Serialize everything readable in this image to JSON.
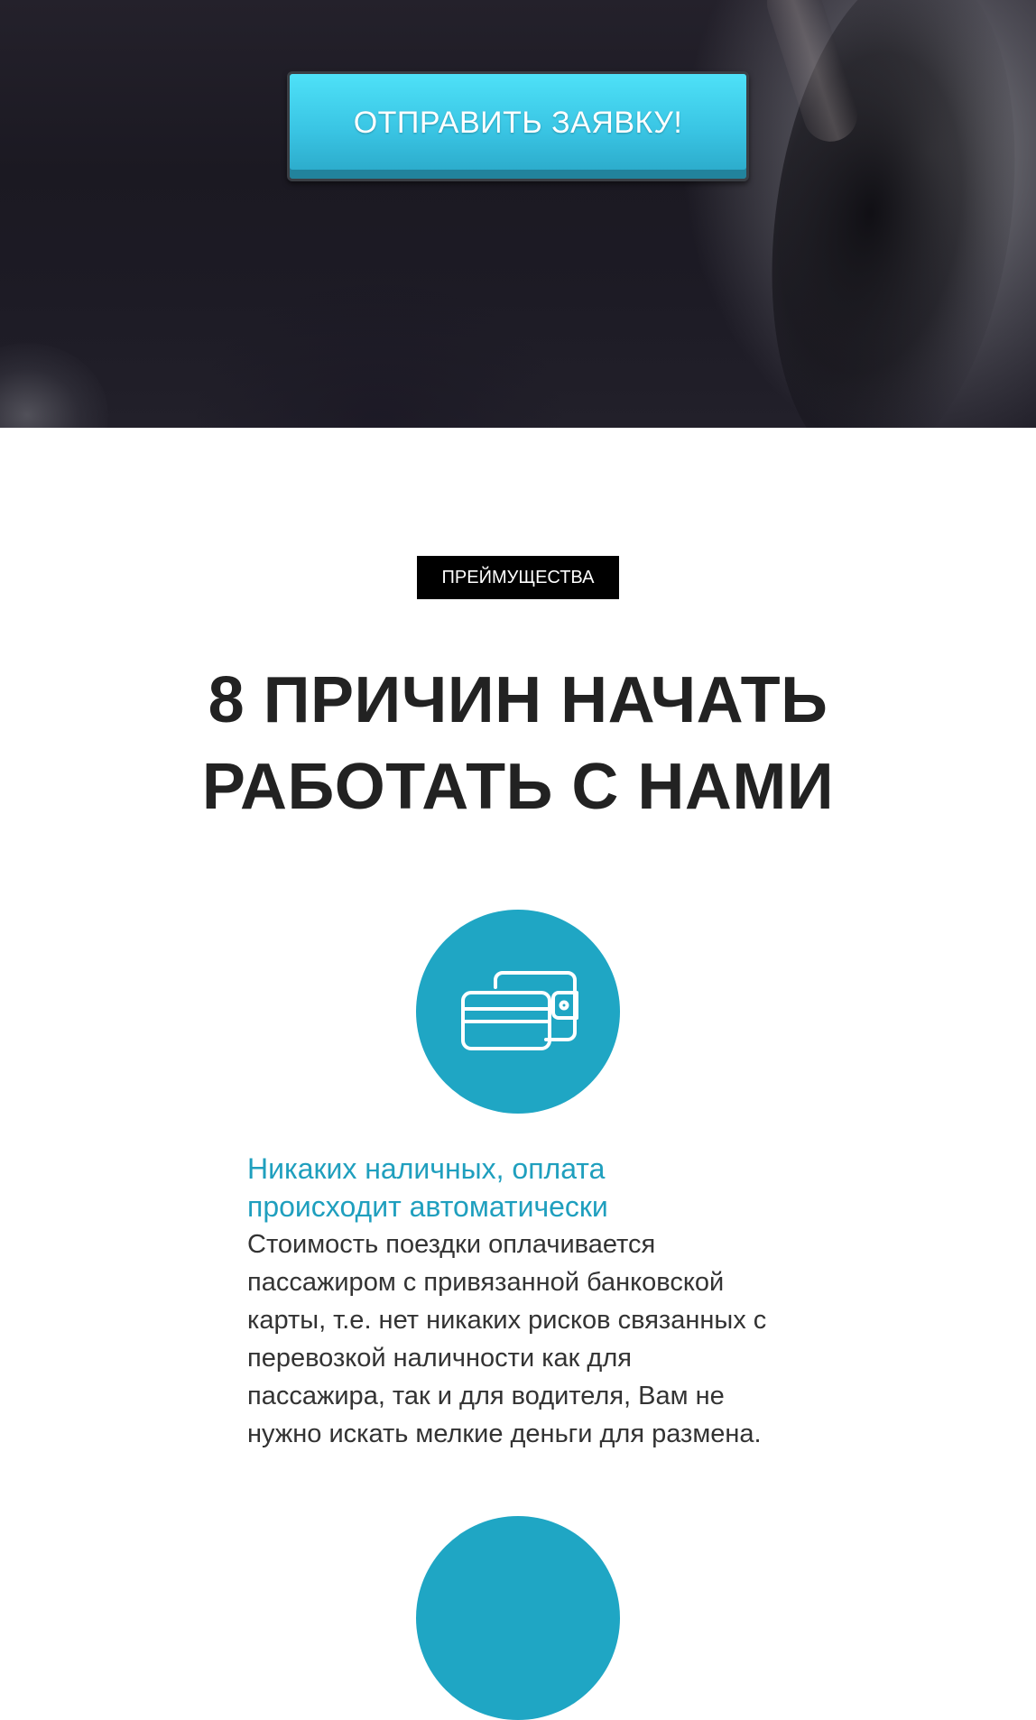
{
  "hero": {
    "cta_label": "ОТПРАВИТЬ ЗАЯВКУ!"
  },
  "advantages": {
    "badge": "ПРЕЙМУЩЕСТВА",
    "title_line1": "8 ПРИЧИН НАЧАТЬ",
    "title_line2": "РАБОТАТЬ С НАМИ",
    "items": [
      {
        "icon": "wallet-card-icon",
        "title_line1": "Никаких наличных, оплата",
        "title_line2": "происходит автоматически",
        "text_lines": [
          "Стоимость поездки оплачивается",
          "пассажиром с привязанной банковской",
          "карты, т.е. нет никаких рисков связанных с",
          "перевозкой наличности как для",
          "пассажира, так и для водителя, Вам не",
          "нужно искать мелкие деньги для размена."
        ]
      }
    ]
  },
  "colors": {
    "accent": "#1fa6c4",
    "button_top": "#4ee1f8",
    "button_bottom": "#2aa7c7",
    "heading": "#222222",
    "badge_bg": "#000000"
  }
}
